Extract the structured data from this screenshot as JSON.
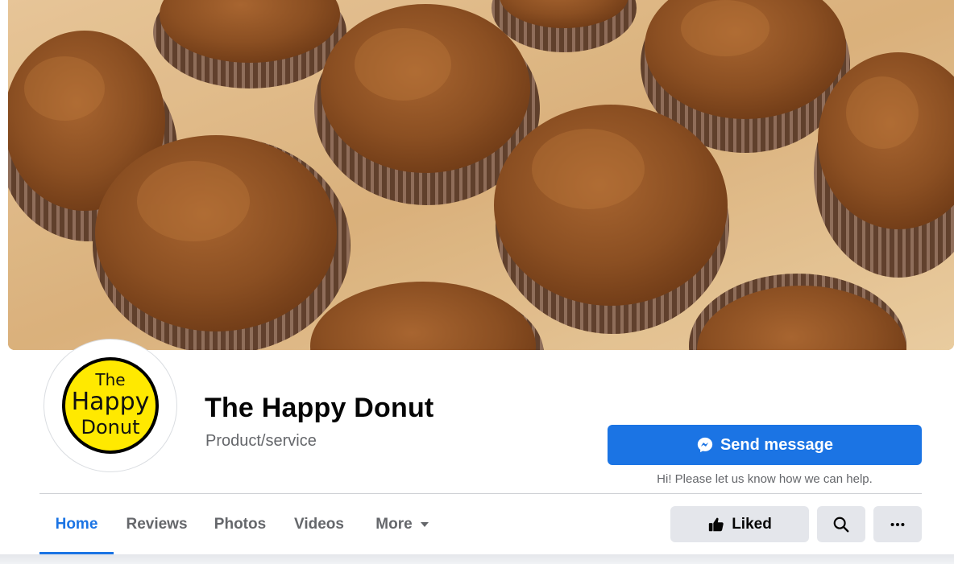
{
  "page": {
    "name": "The Happy Donut",
    "category": "Product/service"
  },
  "cover": {
    "description_icon": "cover-photo"
  },
  "avatar": {
    "logo_lines": [
      "The",
      "Happy",
      "Donut"
    ],
    "logo_color": "#ffe900"
  },
  "actions": {
    "send_message": "Send message",
    "helper": "Hi! Please let us know how we can help.",
    "liked": "Liked",
    "search_icon": "search-icon",
    "more_icon": "more-options-icon"
  },
  "tabs": [
    {
      "label": "Home",
      "active": true
    },
    {
      "label": "Reviews",
      "active": false
    },
    {
      "label": "Photos",
      "active": false
    },
    {
      "label": "Videos",
      "active": false
    },
    {
      "label": "More",
      "active": false
    }
  ],
  "colors": {
    "accent": "#1b74e4",
    "secondary_text": "#65676b",
    "button_gray": "#e4e6eb"
  }
}
